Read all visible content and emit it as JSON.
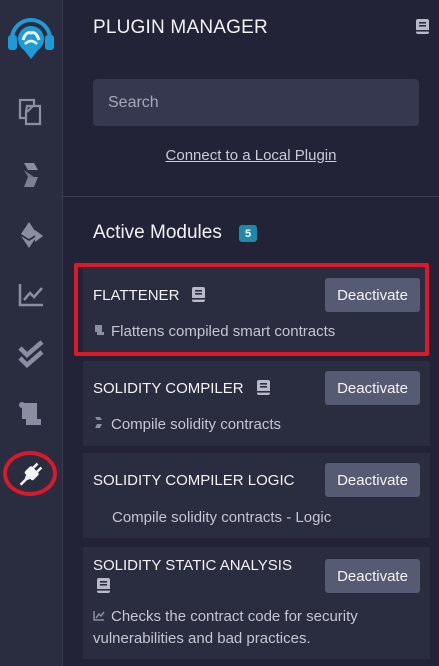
{
  "panel": {
    "title": "PLUGIN MANAGER",
    "search_placeholder": "Search",
    "connect_link": "Connect to a Local Plugin",
    "active_modules_label": "Active Modules",
    "active_count": "5"
  },
  "modules": [
    {
      "name": "FLATTENER",
      "button": "Deactivate",
      "description": "Flattens compiled smart contracts"
    },
    {
      "name": "SOLIDITY COMPILER",
      "button": "Deactivate",
      "description": "Compile solidity contracts"
    },
    {
      "name": "SOLIDITY COMPILER LOGIC",
      "button": "Deactivate",
      "description": "Compile solidity contracts - Logic"
    },
    {
      "name": "SOLIDITY STATIC ANALYSIS",
      "button": "Deactivate",
      "description_line1": "Checks the contract code for security",
      "description_line2": "vulnerabilities and bad practices."
    }
  ],
  "icons": [
    "remix-logo-icon",
    "file-explorer-icon",
    "solidity-compiler-icon",
    "deploy-run-icon",
    "analysis-chart-icon",
    "testing-check-icon",
    "flattener-scroll-icon",
    "plugin-plug-icon",
    "book-icon"
  ],
  "colors": {
    "background": "#222336",
    "sidebar": "#2a2c3f",
    "card": "#2a2c3f",
    "button": "#575a73",
    "badge": "#1d8aa8",
    "highlight": "#d91a2a",
    "logo": "#1e9bd7"
  }
}
